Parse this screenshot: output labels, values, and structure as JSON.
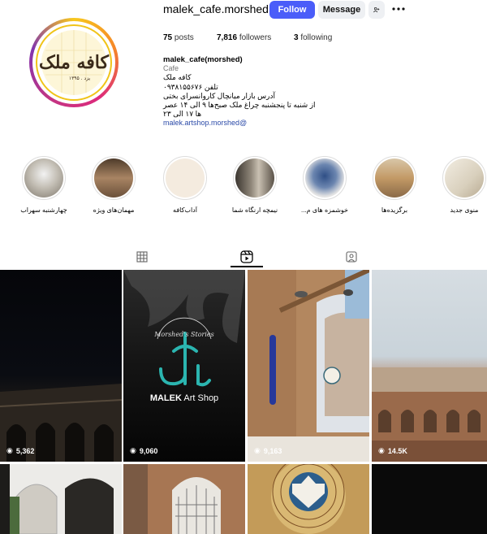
{
  "profile": {
    "username": "malek_cafe.morshed",
    "follow_label": "Follow",
    "message_label": "Message",
    "add_user_icon": "add-person-icon",
    "more_icon": "more-dots-icon",
    "posts_count": "75",
    "posts_label": "posts",
    "followers_count": "7,816",
    "followers_label": "followers",
    "following_count": "3",
    "following_label": "following",
    "logo_text": "کافه ملک",
    "logo_sub": "یزد . ۱۳۹۵",
    "bio_name": "malek_cafe(morshed)",
    "bio_category": "Cafe",
    "bio_lines": [
      "کافه ملک",
      "تلفن ۰۹۳۸۱۵۵۶۷۶",
      "آدرس بازار میانچال کاروانسرای بختی",
      "از شنبه تا پنجشنبه چراغ ملک صبح‌ها ۹ الی ۱۴ عصر",
      "ها ۱۷ الی ۲۳"
    ],
    "bio_link": "malek.artshop.morshed"
  },
  "highlights": [
    {
      "label": "منوی جدید",
      "color": "#e9e3d6"
    },
    {
      "label": "برگزیده‌ها",
      "color": "#c8a57b"
    },
    {
      "label": "خوشمزه های م...",
      "color": "#3a5a8a"
    },
    {
      "label": "نیمچه ارنگاه شما",
      "color": "#7a7064"
    },
    {
      "label": "آداب‌کافه",
      "color": "#f1e6da"
    },
    {
      "label": "مهمان‌های ویژه",
      "color": "#8a6a4e"
    },
    {
      "label": "چهارشنبه سهراب",
      "color": "#b9b4aa"
    }
  ],
  "tabs": [
    {
      "name": "tab-posts",
      "icon": "grid-icon"
    },
    {
      "name": "tab-reels",
      "icon": "reels-icon"
    },
    {
      "name": "tab-tagged",
      "icon": "tagged-icon"
    }
  ],
  "grid": {
    "items": [
      {
        "views": "5,362",
        "scene": "night courtyard"
      },
      {
        "views": "9,060",
        "scene": "MALEK Art Shop logo"
      },
      {
        "views": "9,163",
        "scene": "birds on wall"
      },
      {
        "views": "14.5K",
        "scene": "caravanserai rooftop"
      },
      {
        "scene": "arched window"
      },
      {
        "scene": "brick doorway"
      },
      {
        "scene": "dome ceiling"
      }
    ],
    "reel_logo_text": "MALEK",
    "reel_logo_sub": "Art Shop",
    "reel_logo_arc": "Morshed's Stories"
  }
}
